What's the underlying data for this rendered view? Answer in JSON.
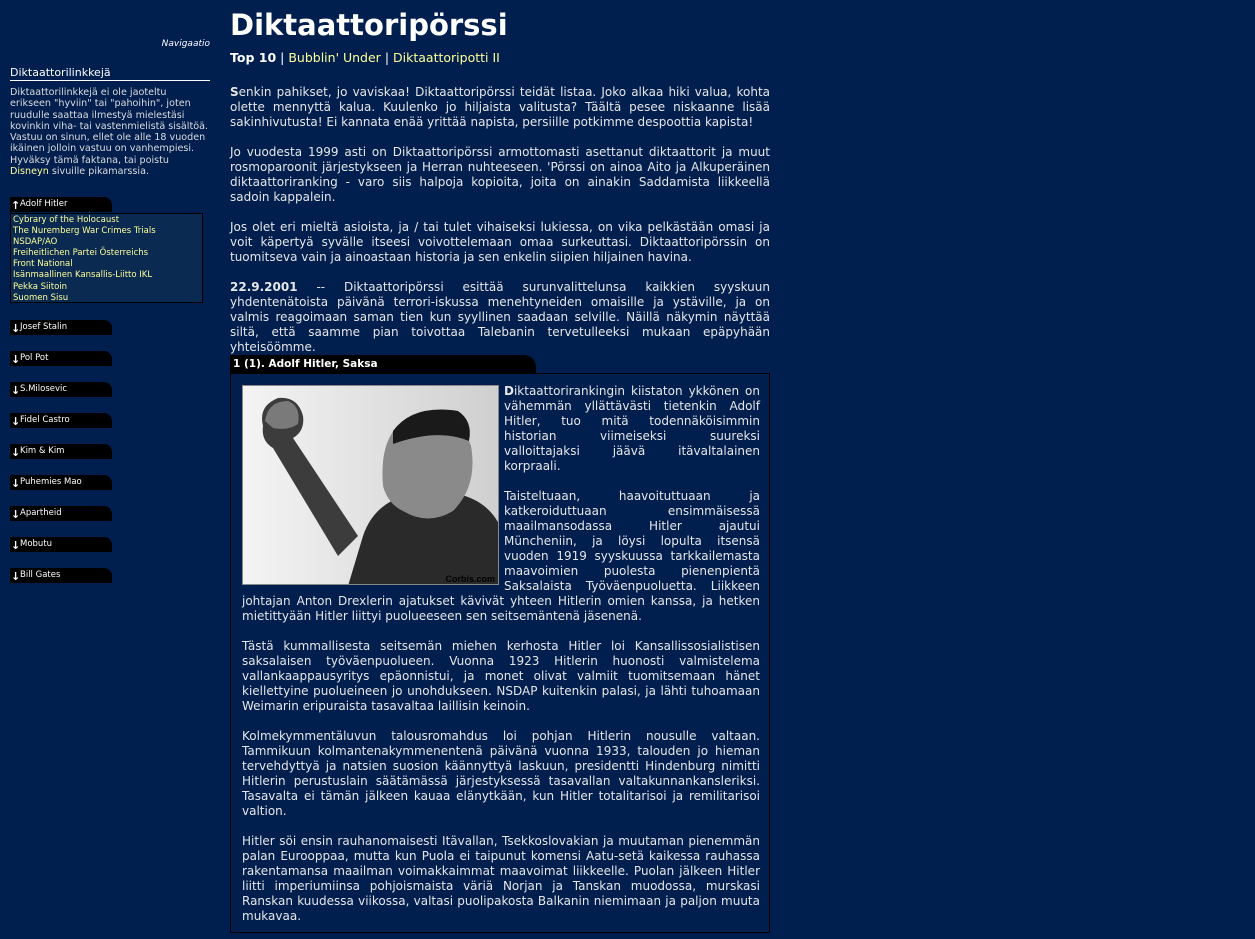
{
  "sidebar": {
    "navi_label": "Navigaatio",
    "title": "Diktaattorilinkkejä",
    "description": "Diktaattorilinkkejä ei ole jaoteltu erikseen \"hyviin\" tai \"pahoihin\", joten ruudulle saattaa ilmestyä mielestäsi kovinkin viha- tai vastenmielistä sisältöä. Vastuu on sinun, ellet ole alle 18 vuoden ikäinen jolloin vastuu on vanhempiesi. Hyväksy tämä faktana, tai poistu",
    "disney_link": "Disneyn",
    "description_end": "sivuille pikamarssia.",
    "open_tab": {
      "arrow": "↑",
      "label": "Adolf Hitler"
    },
    "links": [
      "Cybrary of the Holocaust",
      "The Nuremberg War Crimes Trials",
      "NSDAP/AO",
      "Freiheitlichen Partei Österreichs",
      "Front National",
      "Isänmaallinen Kansallis-Liitto IKL",
      "Pekka Siitoin",
      "Suomen Sisu"
    ],
    "tabs": [
      {
        "arrow": "↓",
        "label": "Josef Stalin"
      },
      {
        "arrow": "↓",
        "label": "Pol Pot"
      },
      {
        "arrow": "↓",
        "label": "S.Milosevic"
      },
      {
        "arrow": "↓",
        "label": "Fidel Castro"
      },
      {
        "arrow": "↓",
        "label": "Kim & Kim"
      },
      {
        "arrow": "↓",
        "label": "Puhemies Mao"
      },
      {
        "arrow": "↓",
        "label": "Apartheid"
      },
      {
        "arrow": "↓",
        "label": "Mobutu"
      },
      {
        "arrow": "↓",
        "label": "Bill Gates"
      }
    ]
  },
  "main": {
    "title": "Diktaattoripörssi",
    "nav": {
      "current": "Top 10",
      "sep": "|",
      "link1": "Bubblin' Under",
      "link2": "Diktaattoripotti II"
    },
    "intro_first": "S",
    "intro_rest": "enkin pahikset, jo vaviskaa! Diktaattoripörssi teidät listaa. Joko alkaa hiki valua, kohta olette mennyttä kalua. Kuulenko jo hiljaista valitusta? Täältä pesee niskaanne lisää sakinhivutusta! Ei kannata enää yrittää napista, persiille potkimme despoottia kapista!",
    "para2": "Jo vuodesta 1999 asti on Diktaattoripörssi armottomasti asettanut diktaattorit ja muut rosmoparoonit järjestykseen ja Herran nuhteeseen. 'Pörssi on ainoa Aito ja Alkuperäinen diktaattoriranking - varo siis halpoja kopioita, joita on ainakin Saddamista liikkeellä sadoin kappalein.",
    "para3": "Jos olet eri mieltä asioista, ja / tai tulet vihaiseksi lukiessa, on vika pelkästään omasi ja voit käpertyä syvälle itseesi voivottelemaan omaa surkeuttasi. Diktaattoripörssin on tuomitseva vain ja ainoastaan historia ja sen enkelin siipien hiljainen havina.",
    "news_date": "22.9.2001",
    "news_text": " -- Diktaattoripörssi esittää surunvalittelunsa kaikkien syyskuun yhdentenätoista päivänä terrori-iskussa menehtyneiden omaisille ja ystäville, ja on valmis reagoimaan saman tien kun syyllinen saadaan selville. Näillä näkymin näyttää siltä, että saamme pian toivottaa Talebanin tervetulleeksi mukaan epäpyhään yhteisöömme."
  },
  "section": {
    "heading": "1 (1). Adolf Hitler, Saksa",
    "photo_credit": "Corbis.com",
    "p1_first": "D",
    "p1_rest": "iktaattorirankingin kiistaton ykkönen on vähemmän yllättävästi tietenkin Adolf Hitler, tuo mitä todennäköisimmin historian viimeiseksi suureksi valloittajaksi jäävä itävaltalainen korpraali.",
    "p2": "Taisteltuaan, haavoituttuaan ja katkeroiduttuaan ensimmäisessä maailmansodassa Hitler ajautui Müncheniin, ja löysi lopulta itsensä vuoden 1919 syyskuussa tarkkailemasta maavoimien puolesta pienenpientä Saksalaista Työväenpuoluetta. Liikkeen johtajan Anton Drexlerin ajatukset kävivät yhteen Hitlerin omien kanssa, ja hetken mietittyään Hitler liittyi puolueeseen sen seitsemäntenä jäsenenä.",
    "p3": "Tästä kummallisesta seitsemän miehen kerhosta Hitler loi Kansallissosialistisen saksalaisen työväenpuolueen. Vuonna 1923 Hitlerin huonosti valmistelema vallankaappausyritys epäonnistui, ja monet olivat valmiit tuomitsemaan hänet kiellettyine puolueineen jo unohdukseen. NSDAP kuitenkin palasi, ja lähti tuhoamaan Weimarin eripuraista tasavaltaa laillisin keinoin.",
    "p4": "Kolmekymmentäluvun talousromahdus loi pohjan Hitlerin nousulle valtaan. Tammikuun kolmantenakymmenentenä päivänä vuonna 1933, talouden jo hieman tervehdyttyä ja natsien suosion käännyttyä laskuun, presidentti Hindenburg nimitti Hitlerin perustuslain säätämässä järjestyksessä tasavallan valtakunnankansleriksi. Tasavalta ei tämän jälkeen kauaa elänytkään, kun Hitler totalitarisoi ja remilitarisoi valtion.",
    "p5": "Hitler söi ensin rauhanomaisesti Itävallan, Tsekkoslovakian ja muutaman pienemmän palan Eurooppaa, mutta kun Puola ei taipunut komensi Aatu-setä kaikessa rauhassa rakentamansa maailman voimakkaimmat maavoimat liikkeelle. Puolan jälkeen Hitler liitti imperiumiinsa pohjoismaista väriä Norjan ja Tanskan muodossa, murskasi Ranskan kuudessa viikossa, valtasi puolipakosta Balkanin niemimaan ja paljon muuta mukavaa."
  }
}
